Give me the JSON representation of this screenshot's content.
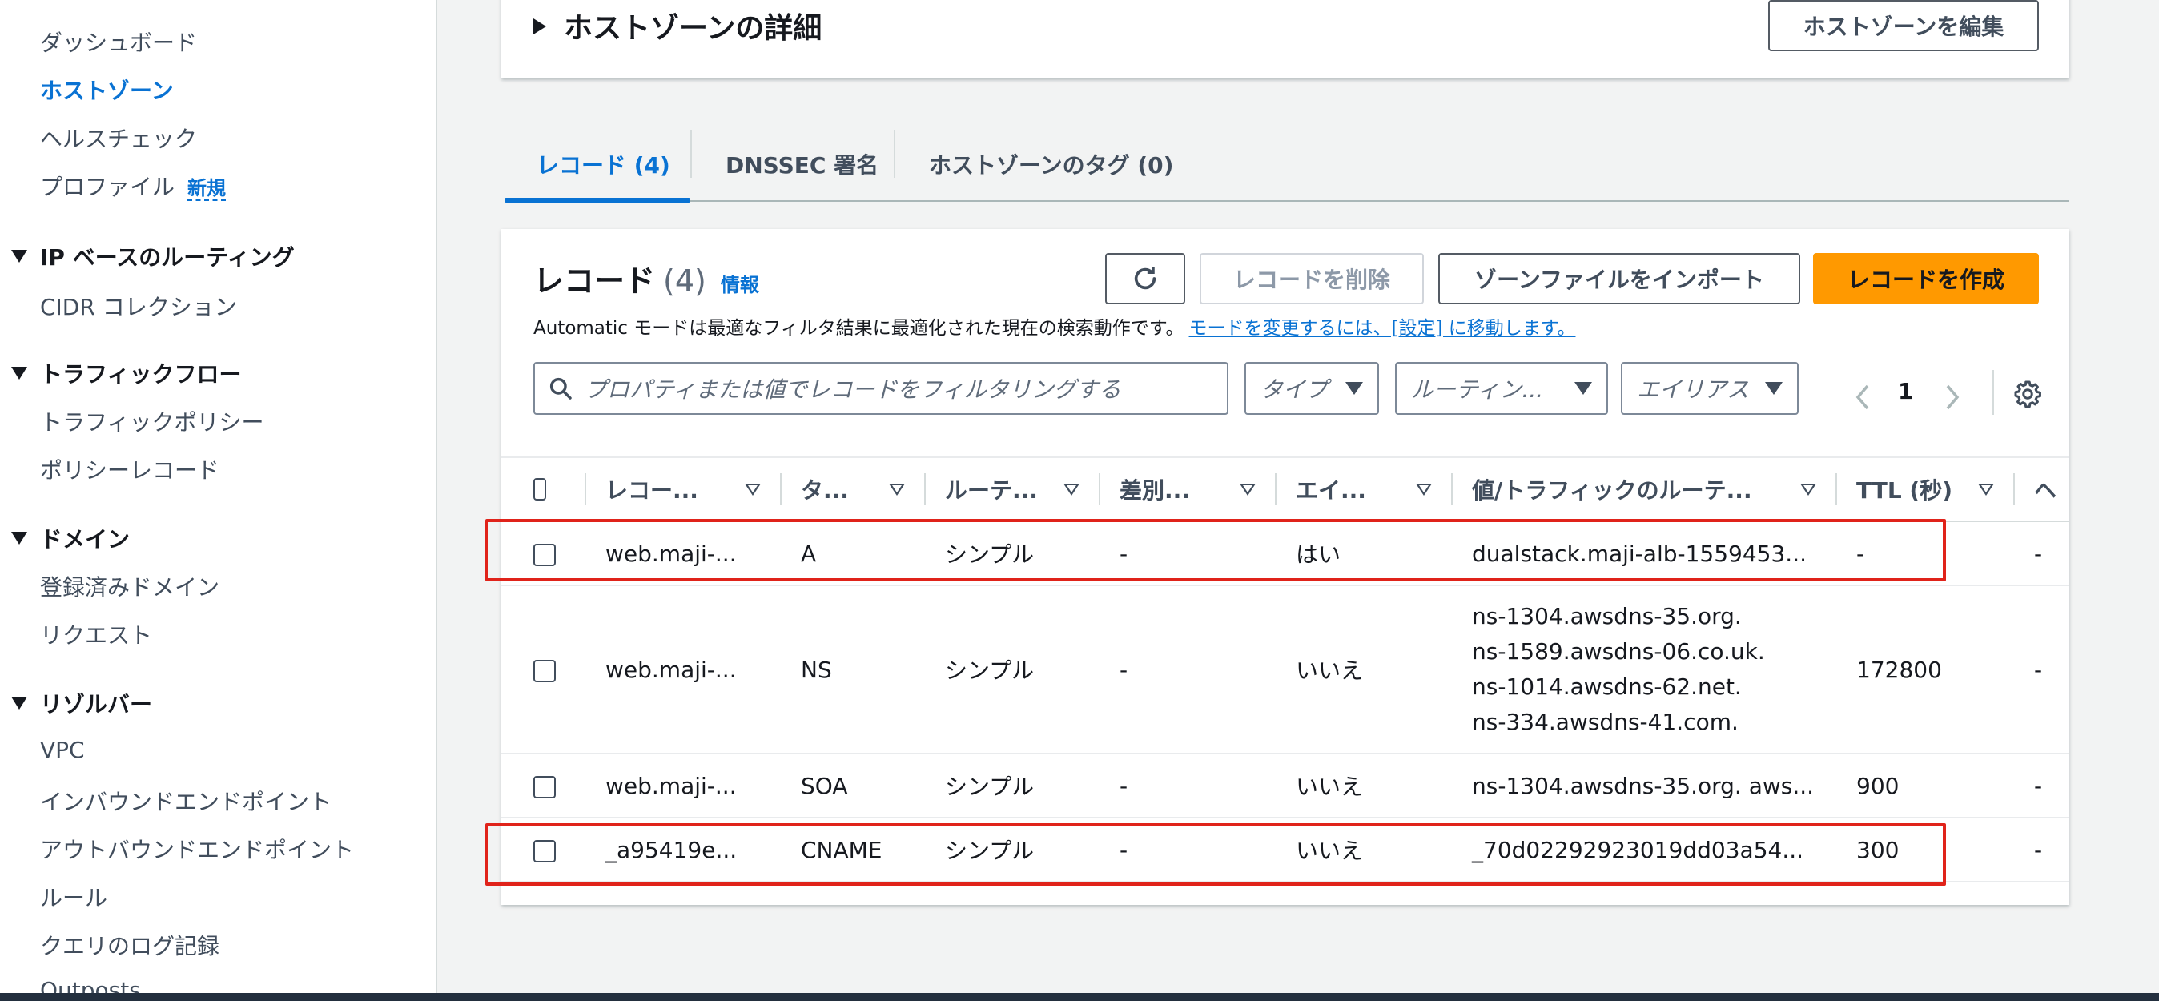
{
  "sidebar": {
    "dashboard": "ダッシュボード",
    "hosted_zones": "ホストゾーン",
    "health_checks": "ヘルスチェック",
    "profiles": "プロファイル",
    "profiles_new": "新規",
    "ip_routing_section": "IP ベースのルーティング",
    "cidr_collections": "CIDR コレクション",
    "traffic_flow_section": "トラフィックフロー",
    "traffic_policies": "トラフィックポリシー",
    "policy_records": "ポリシーレコード",
    "domains_section": "ドメイン",
    "registered_domains": "登録済みドメイン",
    "requests": "リクエスト",
    "resolver_section": "リゾルバー",
    "vpc": "VPC",
    "inbound_endpoints": "インバウンドエンドポイント",
    "outbound_endpoints": "アウトバウンドエンドポイント",
    "rules": "ルール",
    "query_logging": "クエリのログ記録",
    "outposts": "Outposts"
  },
  "details": {
    "title": "ホストゾーンの詳細",
    "edit_button": "ホストゾーンを編集"
  },
  "tabs": {
    "records": "レコード (4)",
    "dnssec": "DNSSEC 署名",
    "tags": "ホストゾーンのタグ (0)"
  },
  "records": {
    "title": "レコード",
    "count": "(4)",
    "info": "情報",
    "delete_button": "レコードを削除",
    "import_button": "ゾーンファイルをインポート",
    "create_button": "レコードを作成",
    "mode_text": "Automatic モードは最適なフィルタ結果に最適化された現在の検索動作です。",
    "mode_link": "モードを変更するには、[設定] に移動します。",
    "search_placeholder": "プロパティまたは値でレコードをフィルタリングする",
    "filter_type": "タイプ",
    "filter_routing": "ルーティン...",
    "filter_alias": "エイリアス",
    "page": "1",
    "columns": [
      "レコー...",
      "タ...",
      "ルーテ...",
      "差別...",
      "エイ...",
      "値/トラフィックのルーテ...",
      "TTL (秒)",
      "ヘ"
    ],
    "rows": [
      {
        "name": "web.maji-...",
        "type": "A",
        "routing": "シンプル",
        "diff": "-",
        "alias": "はい",
        "value": [
          "dualstack.maji-alb-1559453..."
        ],
        "ttl": "-",
        "extra": "-"
      },
      {
        "name": "web.maji-...",
        "type": "NS",
        "routing": "シンプル",
        "diff": "-",
        "alias": "いいえ",
        "value": [
          "ns-1304.awsdns-35.org.",
          "ns-1589.awsdns-06.co.uk.",
          "ns-1014.awsdns-62.net.",
          "ns-334.awsdns-41.com."
        ],
        "ttl": "172800",
        "extra": "-"
      },
      {
        "name": "web.maji-...",
        "type": "SOA",
        "routing": "シンプル",
        "diff": "-",
        "alias": "いいえ",
        "value": [
          "ns-1304.awsdns-35.org. aws..."
        ],
        "ttl": "900",
        "extra": "-"
      },
      {
        "name": "_a95419e...",
        "type": "CNAME",
        "routing": "シンプル",
        "diff": "-",
        "alias": "いいえ",
        "value": [
          "_70d02292923019dd03a54..."
        ],
        "ttl": "300",
        "extra": "-"
      }
    ]
  },
  "colors": {
    "accent": "#0972d3",
    "primary_button": "#ff9900",
    "highlight": "#e0231a"
  },
  "icons": [
    "refresh-icon",
    "search-icon",
    "chevron-left-icon",
    "chevron-right-icon",
    "gear-icon",
    "caret-down-icon",
    "sort-icon"
  ]
}
